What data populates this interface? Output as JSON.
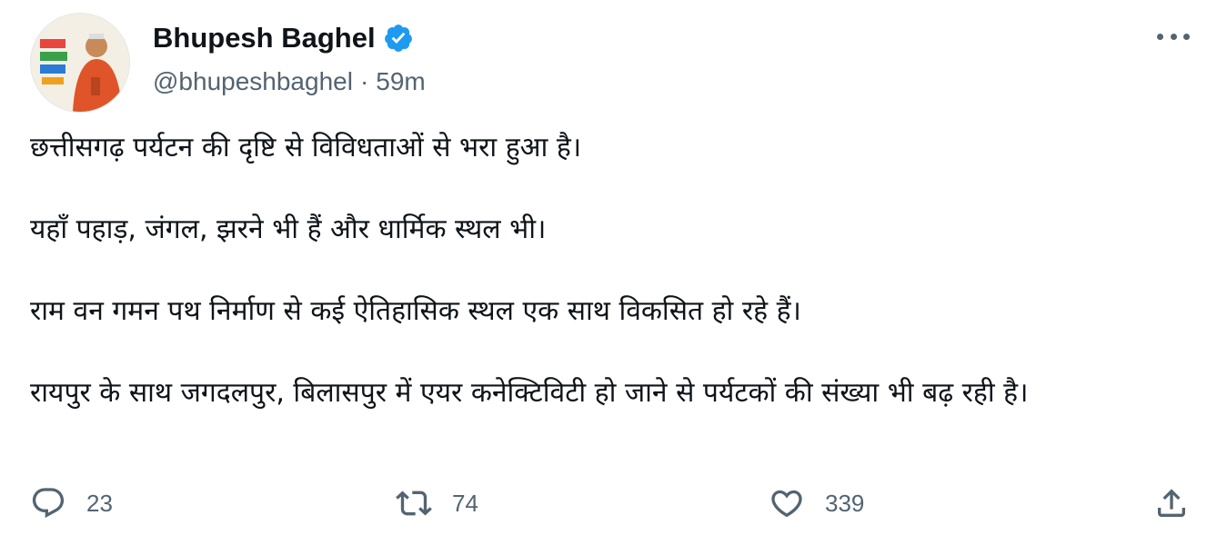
{
  "author": {
    "display_name": "Bhupesh Baghel",
    "handle": "@bhupeshbaghel",
    "separator": "·",
    "time": "59m",
    "verified_icon": "verified-badge-icon",
    "verified_color": "#1d9bf0"
  },
  "tweet": {
    "paragraphs": [
      "छत्तीसगढ़ पर्यटन की दृष्टि से विविधताओं से भरा हुआ है।",
      "यहाँ पहाड़, जंगल, झरने भी हैं और धार्मिक स्थल भी।",
      "राम वन गमन पथ निर्माण से कई ऐतिहासिक स्थल एक साथ विकसित हो रहे हैं।",
      "रायपुर के साथ जगदलपुर, बिलासपुर में एयर कनेक्टिविटी हो जाने से पर्यटकों की संख्या भी बढ़ रही है।"
    ]
  },
  "actions": {
    "replies": "23",
    "retweets": "74",
    "likes": "339",
    "icons": [
      "reply-icon",
      "retweet-icon",
      "like-icon",
      "share-icon"
    ]
  },
  "colors": {
    "text": "#0f1419",
    "secondary": "#536471",
    "accent": "#1d9bf0"
  }
}
